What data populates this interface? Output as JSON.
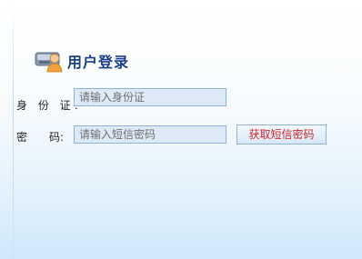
{
  "header": {
    "title": "用户登录",
    "icon": "user-login-icon"
  },
  "form": {
    "id_label": "身 份 证:",
    "id_placeholder": "请输入身份证",
    "code_label_a": "密",
    "code_label_b": "码:",
    "code_placeholder": "请输入短信密码",
    "sms_button_label": "获取短信密码"
  },
  "colors": {
    "title": "#1a3f8a",
    "input_bg": "#dde9f6",
    "input_border": "#8fb3d6",
    "button_text": "#d4262a"
  }
}
